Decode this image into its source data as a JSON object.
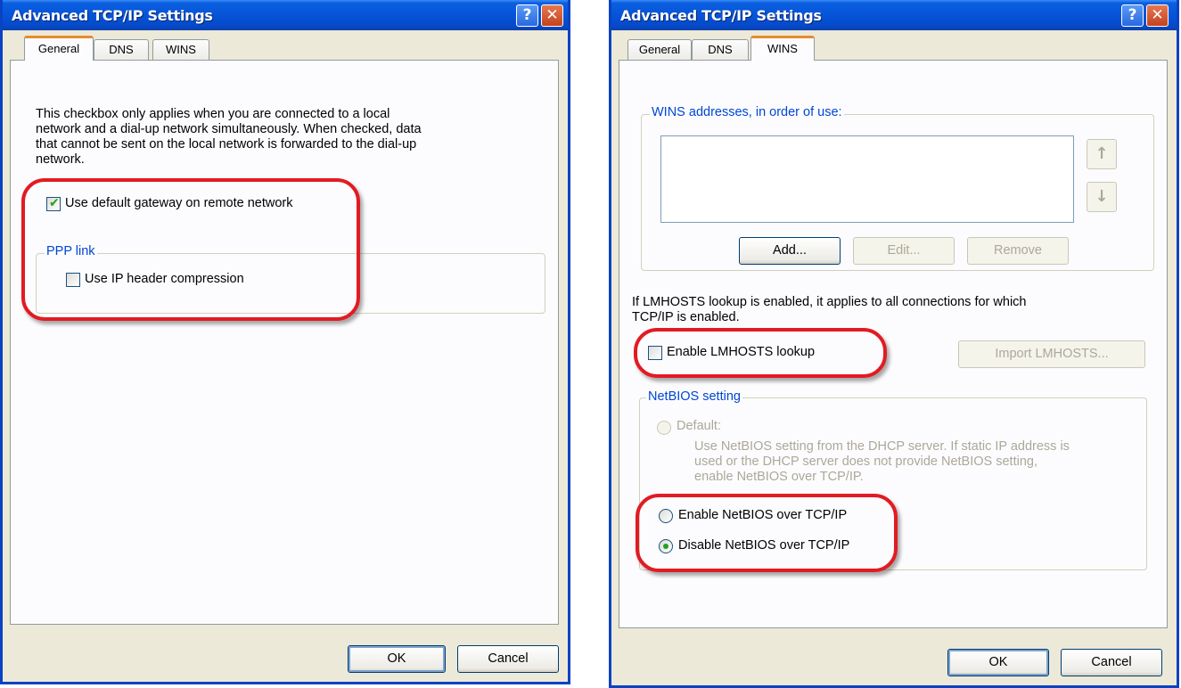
{
  "dialog_general": {
    "title": "Advanced TCP/IP Settings",
    "help_glyph": "?",
    "close_glyph": "✕",
    "tabs": [
      "General",
      "DNS",
      "WINS"
    ],
    "active_tab": "General",
    "description_lines": [
      "This checkbox only applies when you are connected to a local",
      "network and a dial-up network simultaneously.  When checked, data",
      "that cannot be sent on the local network is forwarded to the dial-up",
      "network."
    ],
    "use_default_gateway_label": "Use default gateway on remote network",
    "use_default_gateway_checked": true,
    "ppp_link_legend": "PPP link",
    "ip_header_compression_label": "Use IP header compression",
    "ip_header_compression_checked": false,
    "ok_label": "OK",
    "cancel_label": "Cancel"
  },
  "dialog_wins": {
    "title": "Advanced TCP/IP Settings",
    "help_glyph": "?",
    "close_glyph": "✕",
    "tabs": [
      "General",
      "DNS",
      "WINS"
    ],
    "active_tab": "WINS",
    "wins_addresses_legend": "WINS addresses, in order of use:",
    "move_up_glyph": "↑",
    "move_down_glyph": "↓",
    "add_label": "Add...",
    "edit_label": "Edit...",
    "remove_label": "Remove",
    "lmhosts_info_lines": [
      "If LMHOSTS lookup is enabled, it applies to all connections for which",
      "TCP/IP is enabled."
    ],
    "enable_lmhosts_label": "Enable LMHOSTS lookup",
    "enable_lmhosts_checked": false,
    "import_lmhosts_label": "Import LMHOSTS...",
    "netbios_legend": "NetBIOS setting",
    "default_radio_label": "Default:",
    "default_description_lines": [
      "Use NetBIOS setting from the DHCP server. If static IP address is",
      "used or the DHCP server does not provide NetBIOS setting,",
      "enable NetBIOS over TCP/IP."
    ],
    "enable_netbios_label": "Enable NetBIOS over TCP/IP",
    "disable_netbios_label": "Disable NetBIOS over TCP/IP",
    "selected_netbios_option": "Disable NetBIOS over TCP/IP",
    "ok_label": "OK",
    "cancel_label": "Cancel"
  },
  "colors": {
    "highlight_outline": "#e21b22",
    "title_bar": "#0654d8",
    "dialog_bg": "#ece9d8",
    "group_legend": "#0046d5"
  }
}
